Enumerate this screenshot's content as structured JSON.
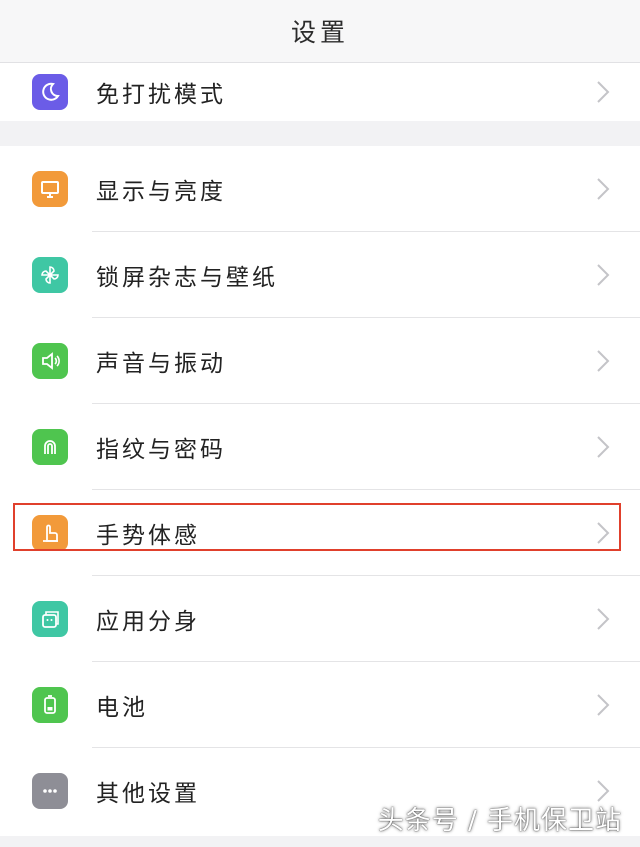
{
  "header": {
    "title": "设置"
  },
  "items": [
    {
      "label": "免打扰模式",
      "icon": "moon-icon",
      "color": "#6b5ce7"
    },
    {
      "label": "显示与亮度",
      "icon": "monitor-icon",
      "color": "#f29a3a"
    },
    {
      "label": "锁屏杂志与壁纸",
      "icon": "pinwheel-icon",
      "color": "#3fc7a4"
    },
    {
      "label": "声音与振动",
      "icon": "speaker-icon",
      "color": "#4fc54f"
    },
    {
      "label": "指纹与密码",
      "icon": "fingerprint-icon",
      "color": "#4fc54f"
    },
    {
      "label": "手势体感",
      "icon": "gesture-hand-icon",
      "color": "#f29a3a"
    },
    {
      "label": "应用分身",
      "icon": "app-clone-icon",
      "color": "#3fc7a4"
    },
    {
      "label": "电池",
      "icon": "battery-icon",
      "color": "#4fc54f"
    },
    {
      "label": "其他设置",
      "icon": "more-icon",
      "color": "#8e8e96"
    }
  ],
  "watermark": "头条号 / 手机保卫站",
  "highlight_color": "#e0402c"
}
